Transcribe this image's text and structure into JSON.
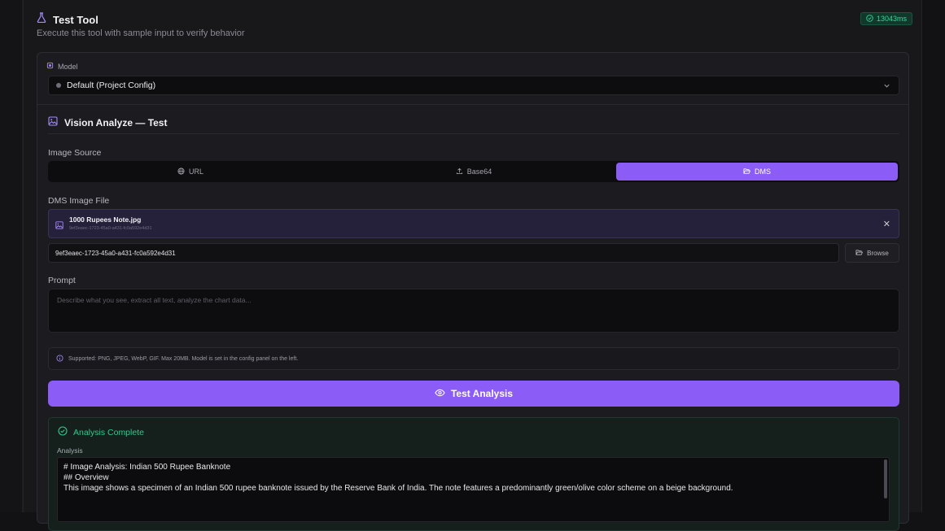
{
  "header": {
    "title": "Test Tool",
    "subtitle": "Execute this tool with sample input to verify behavior",
    "timer": "13043ms"
  },
  "model": {
    "label": "Model",
    "selected": "Default (Project Config)"
  },
  "section": {
    "title": "Vision Analyze — Test"
  },
  "image_source": {
    "label": "Image Source",
    "options": [
      "URL",
      "Base64",
      "DMS"
    ],
    "active": "DMS"
  },
  "dms": {
    "label": "DMS Image File",
    "file_name": "1000 Rupees Note.jpg",
    "file_id": "9ef3eaec-1723-45a0-a431-fc0a592e4d31",
    "id_value": "9ef3eaec-1723-45a0-a431-fc0a592e4d31",
    "browse_label": "Browse"
  },
  "prompt": {
    "label": "Prompt",
    "placeholder": "Describe what you see, extract all text, analyze the chart data..."
  },
  "info": {
    "text": "Supported: PNG, JPEG, WebP, GIF. Max 20MB. Model is set in the config panel on the left."
  },
  "cta": {
    "label": "Test Analysis"
  },
  "result": {
    "status": "Analysis Complete",
    "analysis_label": "Analysis",
    "lines": [
      "# Image Analysis: Indian 500 Rupee Banknote",
      "",
      "## Overview",
      "This image shows a specimen of an Indian 500 rupee banknote issued by the Reserve Bank of India. The note features a predominantly green/olive color scheme on a beige background."
    ]
  },
  "colors": {
    "accent": "#8b5cf6",
    "success": "#33c88d",
    "panel": "#18181b"
  }
}
